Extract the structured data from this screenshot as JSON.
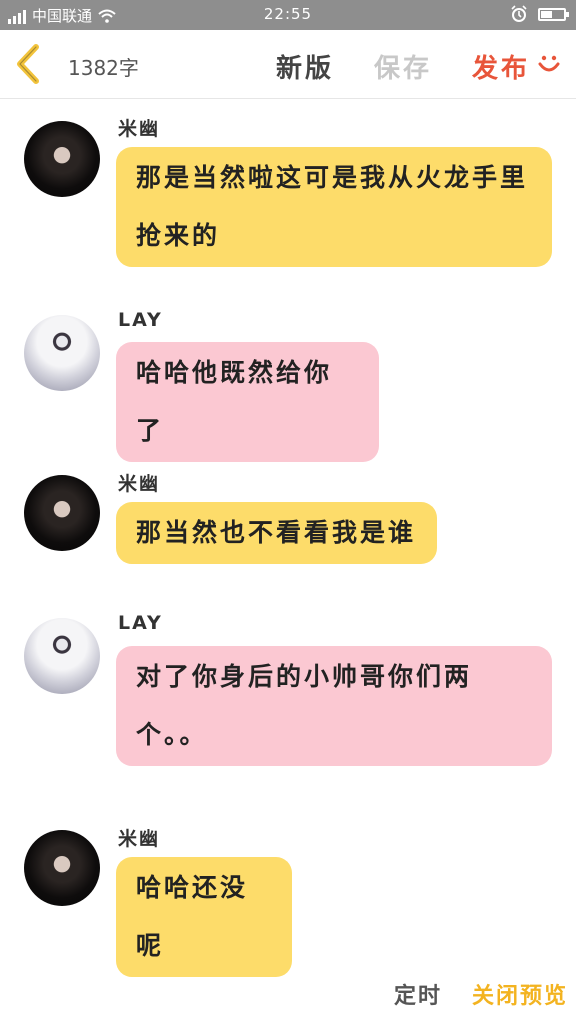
{
  "status_bar": {
    "carrier": "中国联通",
    "time": "22:55",
    "battery_level": 0.45,
    "icons": [
      "signal-icon",
      "wifi-icon",
      "alarm-icon",
      "battery-icon"
    ]
  },
  "toolbar": {
    "back_icon": "chevron-left-icon",
    "word_count": "1382字",
    "new_version_label": "新版",
    "save_label": "保存",
    "publish_label": "发布",
    "smile_icon": "smile-icon"
  },
  "messages": [
    {
      "speaker": "米幽",
      "text": "那是当然啦这可是我从火龙手里抢来的",
      "color": "#fddc6a"
    },
    {
      "speaker": "LAY",
      "text": "哈哈他既然给你了",
      "color": "#fbc8d2"
    },
    {
      "speaker": "米幽",
      "text": "那当然也不看看我是谁",
      "color": "#fddc6a"
    },
    {
      "speaker": "LAY",
      "text": "对了你身后的小帅哥你们两个。。",
      "color": "#fbc8d2"
    },
    {
      "speaker": "米幽",
      "text": "哈哈还没呢",
      "color": "#fddc6a"
    }
  ],
  "bottom": {
    "timer_label": "定时",
    "close_preview_label": "关闭预览"
  },
  "colors": {
    "accent_publish": "#e8553a",
    "accent_preview": "#f3b320",
    "bubble_yellow": "#fddc6a",
    "bubble_pink": "#fbc8d2"
  }
}
